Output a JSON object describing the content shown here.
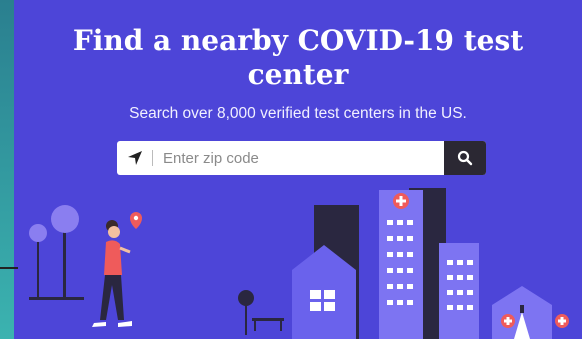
{
  "hero": {
    "title_line1": "Find a nearby COVID-19 test",
    "title_line2": "center",
    "subtitle": "Search over 8,000 verified test centers in the US."
  },
  "search": {
    "placeholder": "Enter zip code",
    "value": ""
  },
  "icons": {
    "location": "location-arrow-icon",
    "search": "search-icon"
  },
  "colors": {
    "background": "#4d45d8",
    "accent": "#ef5b5b",
    "button": "#2b2833"
  }
}
